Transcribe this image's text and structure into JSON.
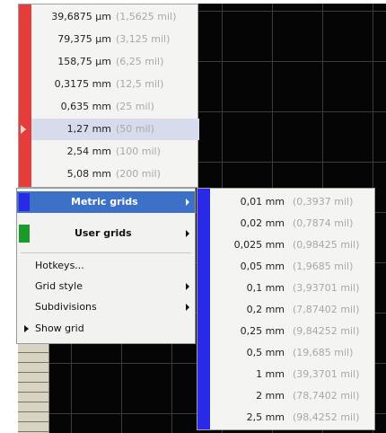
{
  "top_menu": {
    "items": [
      {
        "value": "39,6875 µm",
        "sub": "(1,5625 mil)"
      },
      {
        "value": "79,375 µm",
        "sub": "(3,125 mil)"
      },
      {
        "value": "158,75 µm",
        "sub": "(6,25 mil)"
      },
      {
        "value": "0,3175 mm",
        "sub": "(12,5 mil)"
      },
      {
        "value": "0,635 mm",
        "sub": "(25 mil)"
      },
      {
        "value": "1,27 mm",
        "sub": "(50 mil)"
      },
      {
        "value": "2,54 mm",
        "sub": "(100 mil)"
      },
      {
        "value": "5,08 mm",
        "sub": "(200 mil)"
      }
    ],
    "selected_index": 5,
    "accent_color": "#e53c3c"
  },
  "context_menu": {
    "metric_grids": "Metric grids",
    "user_grids": "User grids",
    "hotkeys": "Hotkeys...",
    "grid_style": "Grid style",
    "subdivisions": "Subdivisions",
    "show_grid": "Show grid",
    "metric_color": "#2a2ae6",
    "user_color": "#1a9a2a",
    "highlight_color": "#3d71c8"
  },
  "metric_submenu": {
    "items": [
      {
        "value": "0,01 mm",
        "sub": "(0,3937 mil)"
      },
      {
        "value": "0,02 mm",
        "sub": "(0,7874 mil)"
      },
      {
        "value": "0,025 mm",
        "sub": "(0,98425 mil)"
      },
      {
        "value": "0,05 mm",
        "sub": "(1,9685 mil)"
      },
      {
        "value": "0,1 mm",
        "sub": "(3,93701 mil)"
      },
      {
        "value": "0,2 mm",
        "sub": "(7,87402 mil)"
      },
      {
        "value": "0,25 mm",
        "sub": "(9,84252 mil)"
      },
      {
        "value": "0,5 mm",
        "sub": "(19,685 mil)"
      },
      {
        "value": "1 mm",
        "sub": "(39,3701 mil)"
      },
      {
        "value": "2 mm",
        "sub": "(78,7402 mil)"
      },
      {
        "value": "2,5 mm",
        "sub": "(98,4252 mil)"
      }
    ],
    "accent_color": "#2a2ae6"
  }
}
